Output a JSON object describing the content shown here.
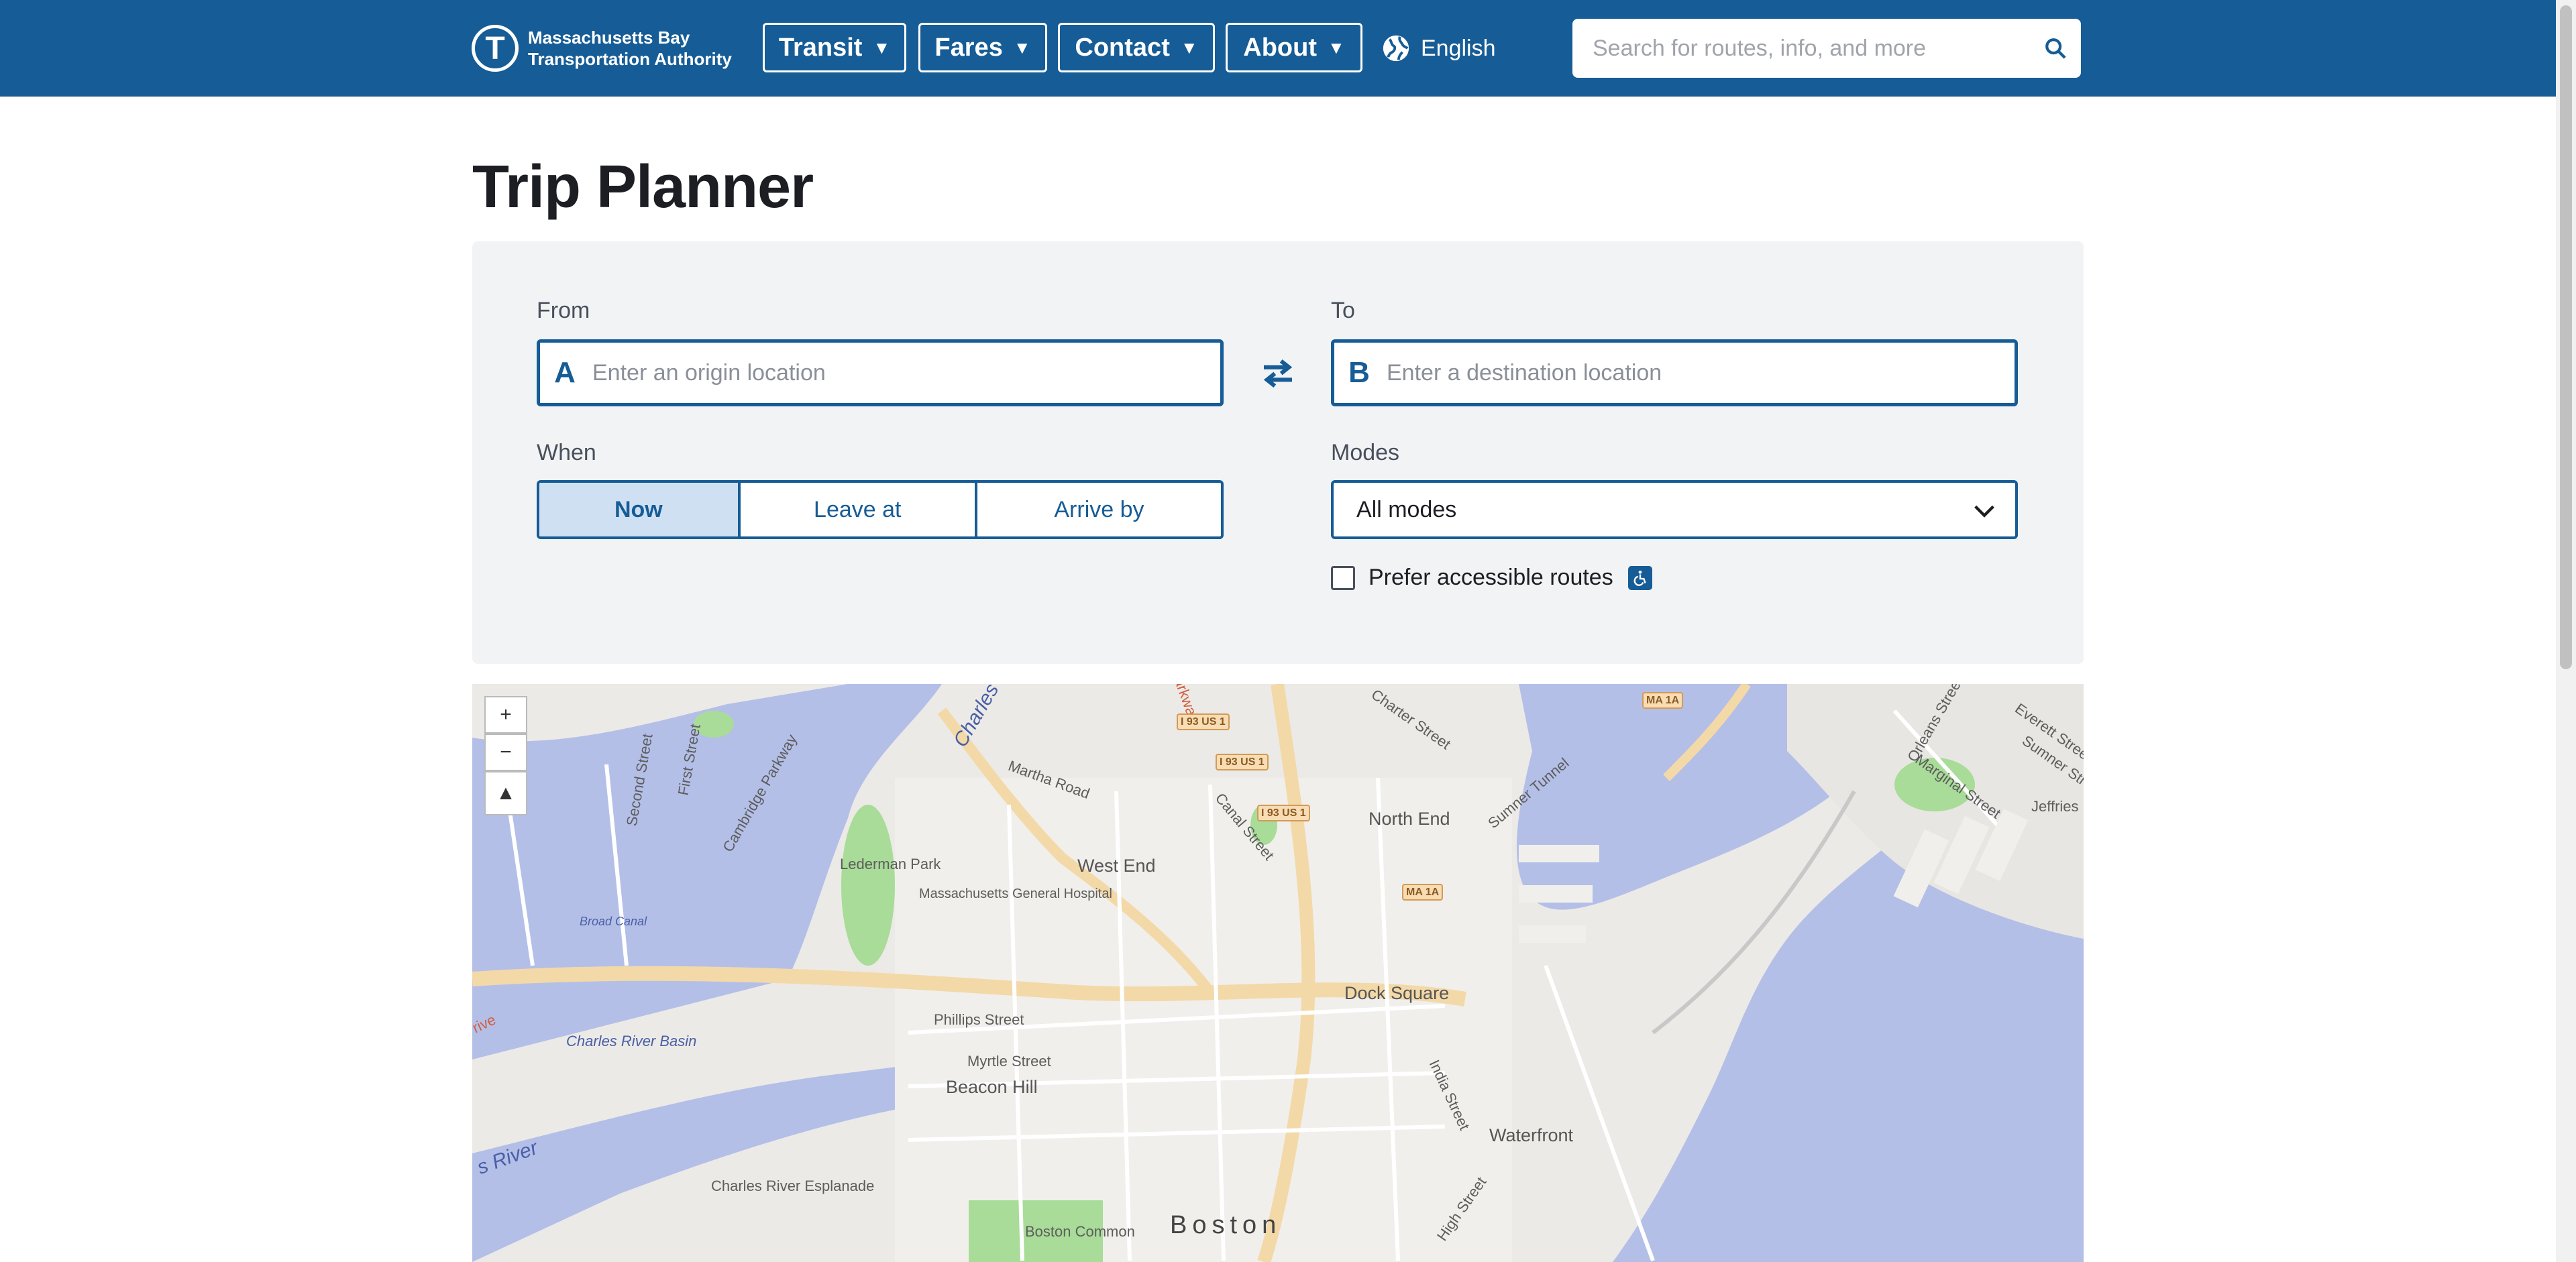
{
  "header": {
    "logo_line1": "Massachusetts Bay",
    "logo_line2": "Transportation Authority",
    "logo_mark": "T",
    "nav": [
      {
        "label": "Transit"
      },
      {
        "label": "Fares"
      },
      {
        "label": "Contact"
      },
      {
        "label": "About"
      }
    ],
    "language": "English",
    "search_placeholder": "Search for routes, info, and more"
  },
  "page": {
    "title": "Trip Planner"
  },
  "planner": {
    "from_label": "From",
    "from_letter": "A",
    "from_placeholder": "Enter an origin location",
    "to_label": "To",
    "to_letter": "B",
    "to_placeholder": "Enter a destination location",
    "when_label": "When",
    "when_options": [
      {
        "label": "Now",
        "selected": true
      },
      {
        "label": "Leave at",
        "selected": false
      },
      {
        "label": "Arrive by",
        "selected": false
      }
    ],
    "modes_label": "Modes",
    "modes_value": "All modes",
    "accessible_label": "Prefer accessible routes",
    "accessible_checked": false
  },
  "map": {
    "labels": [
      "Charles River Basin",
      "Broad Canal",
      "Lederman Park",
      "Massachusetts General Hospital",
      "West End",
      "North End",
      "Dock Square",
      "Phillips Street",
      "Myrtle Street",
      "Beacon Hill",
      "Charles River Esplanade",
      "Boston Common",
      "Boston",
      "Waterfront",
      "Martha Road",
      "Canal Street",
      "Cambridge Parkway",
      "Second Street",
      "First Street",
      "Charter Street",
      "Sumner Tunnel",
      "India Street",
      "High Street",
      "Marginal Street",
      "Everett Street",
      "Sumner Street",
      "Orleans Street",
      "Jeffries",
      "Charles",
      "Parkway",
      "s River",
      "rive"
    ],
    "shields": [
      "I 93 US 1",
      "I 93 US 1",
      "I 93 US 1",
      "MA 1A",
      "MA 1A"
    ],
    "zoom_in": "+",
    "zoom_out": "−",
    "compass": "▲"
  },
  "colors": {
    "brand": "#165c96",
    "panel_bg": "#f2f3f5",
    "water": "#b4bfe8",
    "park": "#a8dc98"
  }
}
